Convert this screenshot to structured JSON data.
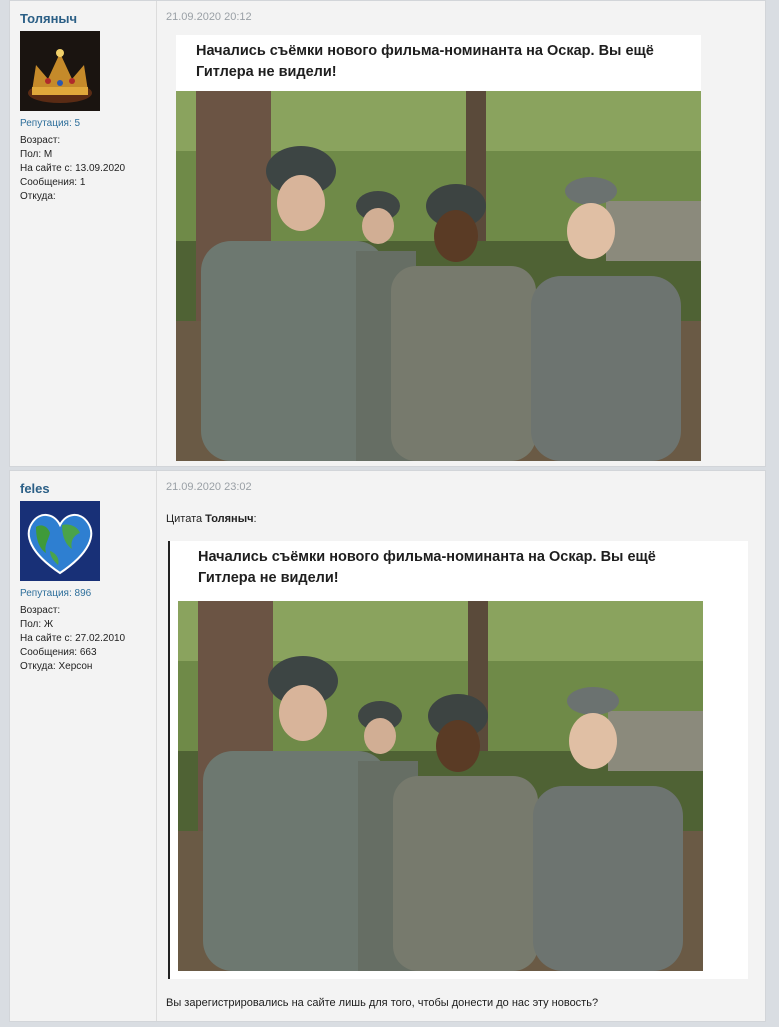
{
  "posts": [
    {
      "author": "Толяныч",
      "reputation": "Репутация: 5",
      "info": {
        "age": "Возраст:",
        "gender": "Пол: М",
        "joined": "На сайте с: 13.09.2020",
        "messages": "Сообщения: 1",
        "from": "Откуда:"
      },
      "date": "21.09.2020 20:12",
      "meme_caption": "Начались съёмки нового фильма-номинанта на Оскар. Вы ещё Гитлера не видели!",
      "avatar_icon": "crown-avatar-icon"
    },
    {
      "author": "feles",
      "reputation": "Репутация: 896",
      "info": {
        "age": "Возраст:",
        "gender": "Пол: Ж",
        "joined": "На сайте с: 27.02.2010",
        "messages": "Сообщения: 663",
        "from": "Откуда: Херсон"
      },
      "date": "21.09.2020 23:02",
      "quote_prefix": "Цитата",
      "quote_author": "Толяныч",
      "quote_suffix": ":",
      "meme_caption": "Начались съёмки нового фильма-номинанта на Оскар. Вы ещё Гитлера не видели!",
      "reply": "Вы зарегистрировались на сайте лишь для того, чтобы донести до нас эту новость?",
      "avatar_icon": "heart-globe-avatar-icon"
    }
  ],
  "colors": {
    "username": "#2b5f86",
    "reputation": "#2e6f9b",
    "date": "#9aa0a6",
    "post_bg": "#f3f3f3",
    "page_bg": "#d9dde2"
  }
}
